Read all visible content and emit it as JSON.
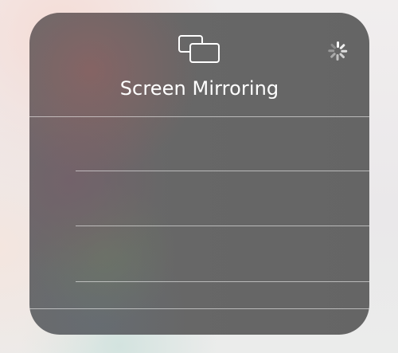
{
  "screen_mirroring": {
    "title": "Screen Mirroring",
    "icon": "screen-mirroring-icon",
    "status_icon": "activity-spinner-icon",
    "state": "searching",
    "devices": [
      {
        "label": ""
      },
      {
        "label": ""
      },
      {
        "label": ""
      }
    ]
  }
}
